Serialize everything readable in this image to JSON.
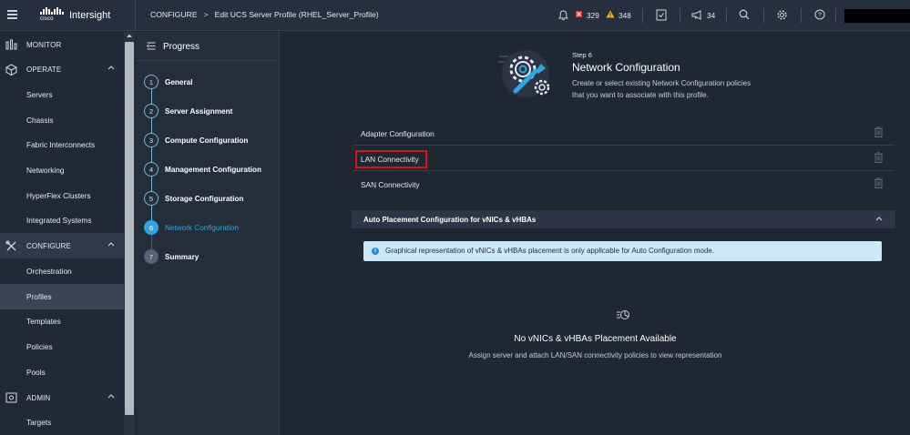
{
  "brand": {
    "name": "Intersight",
    "mark_text": "cisco"
  },
  "breadcrumb": {
    "section": "CONFIGURE",
    "separator": ">",
    "page": "Edit UCS Server Profile (RHEL_Server_Profile)"
  },
  "alerts": {
    "critical": "329",
    "warning": "348",
    "announcements": "34"
  },
  "sidebar": {
    "monitor": "MONITOR",
    "operate": "OPERATE",
    "operate_items": [
      "Servers",
      "Chassis",
      "Fabric Interconnects",
      "Networking",
      "HyperFlex Clusters",
      "Integrated Systems"
    ],
    "configure": "CONFIGURE",
    "configure_items": [
      "Orchestration",
      "Profiles",
      "Templates",
      "Policies",
      "Pools"
    ],
    "admin": "ADMIN",
    "admin_items": [
      "Targets"
    ]
  },
  "progress": {
    "title": "Progress",
    "steps": [
      {
        "num": "1",
        "label": "General"
      },
      {
        "num": "2",
        "label": "Server Assignment"
      },
      {
        "num": "3",
        "label": "Compute Configuration"
      },
      {
        "num": "4",
        "label": "Management Configuration"
      },
      {
        "num": "5",
        "label": "Storage Configuration"
      },
      {
        "num": "6",
        "label": "Network Configuration"
      },
      {
        "num": "7",
        "label": "Summary"
      }
    ]
  },
  "main": {
    "step_label": "Step 6",
    "title": "Network Configuration",
    "description": "Create or select existing Network Configuration policies that you want to associate with this profile.",
    "policies": [
      "Adapter Configuration",
      "LAN Connectivity",
      "SAN Connectivity"
    ],
    "auto_placement": "Auto Placement Configuration for vNICs & vHBAs",
    "info_icon": "i",
    "info_text": "Graphical representation of vNICs & vHBAs placement is only applicable for Auto Configuration mode.",
    "empty_title": "No vNICs & vHBAs Placement Available",
    "empty_desc": "Assign server and attach LAN/SAN connectivity policies to view representation"
  },
  "colors": {
    "accent": "#2ea7e0",
    "highlight": "#d5141c",
    "critical": "#e2363c",
    "warning": "#f5b800"
  }
}
